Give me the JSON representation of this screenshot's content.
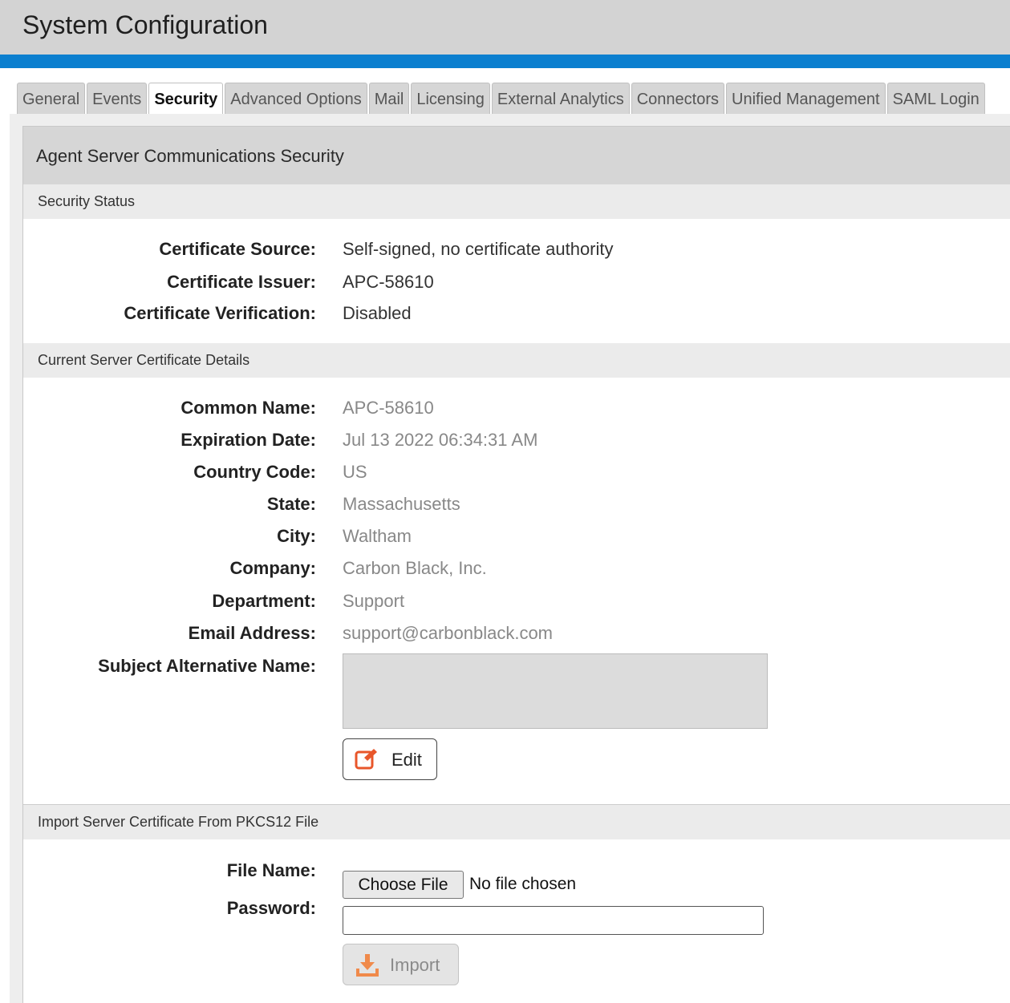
{
  "header": {
    "title": "System Configuration"
  },
  "tabs": [
    {
      "label": "General",
      "active": false
    },
    {
      "label": "Events",
      "active": false
    },
    {
      "label": "Security",
      "active": true
    },
    {
      "label": "Advanced Options",
      "active": false
    },
    {
      "label": "Mail",
      "active": false
    },
    {
      "label": "Licensing",
      "active": false
    },
    {
      "label": "External Analytics",
      "active": false
    },
    {
      "label": "Connectors",
      "active": false
    },
    {
      "label": "Unified Management",
      "active": false
    },
    {
      "label": "SAML Login",
      "active": false
    }
  ],
  "section": {
    "title": "Agent Server Communications Security"
  },
  "security_status": {
    "header": "Security Status",
    "rows": [
      {
        "label": "Certificate Source:",
        "value": "Self-signed, no certificate authority"
      },
      {
        "label": "Certificate Issuer:",
        "value": "APC-58610"
      },
      {
        "label": "Certificate Verification:",
        "value": "Disabled"
      }
    ]
  },
  "cert_details": {
    "header": "Current Server Certificate Details",
    "rows": [
      {
        "label": "Common Name:",
        "value": "APC-58610"
      },
      {
        "label": "Expiration Date:",
        "value": "Jul 13 2022 06:34:31 AM"
      },
      {
        "label": "Country Code:",
        "value": "US"
      },
      {
        "label": "State:",
        "value": "Massachusetts"
      },
      {
        "label": "City:",
        "value": "Waltham"
      },
      {
        "label": "Company:",
        "value": "Carbon Black, Inc."
      },
      {
        "label": "Department:",
        "value": "Support"
      },
      {
        "label": "Email Address:",
        "value": "support@carbonblack.com"
      }
    ],
    "san_label": "Subject Alternative Name:",
    "san_value": "",
    "edit_label": "Edit"
  },
  "import": {
    "header": "Import Server Certificate From PKCS12 File",
    "file_label": "File Name:",
    "choose_file_label": "Choose File",
    "file_status": "No file chosen",
    "password_label": "Password:",
    "password_value": "",
    "import_label": "Import"
  },
  "colors": {
    "accent_blue": "#0b7fcf",
    "edit_icon": "#e8562a",
    "import_icon": "#f08a4b"
  },
  "icons": {
    "edit": "edit-icon",
    "import": "download-icon"
  }
}
